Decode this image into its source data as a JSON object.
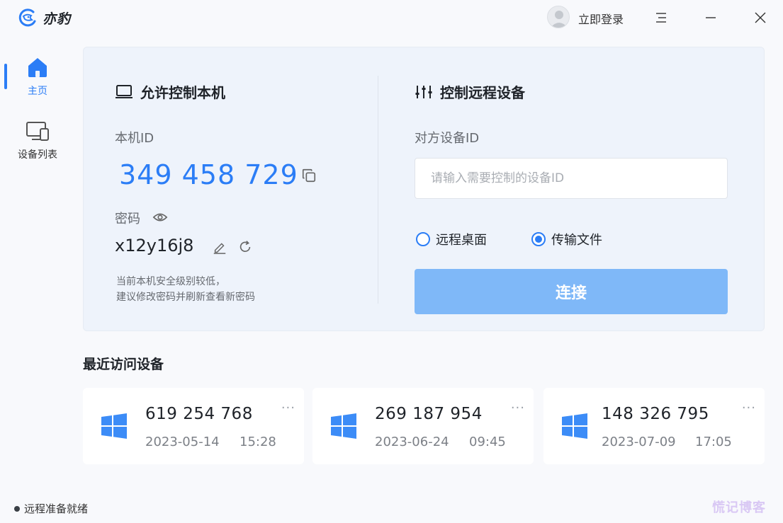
{
  "app": {
    "name": "亦豹"
  },
  "header": {
    "login_label": "立即登录"
  },
  "sidebar": {
    "items": [
      {
        "label": "主页",
        "icon": "home-icon",
        "active": true
      },
      {
        "label": "设备列表",
        "icon": "devices-icon",
        "active": false
      }
    ]
  },
  "local": {
    "title": "允许控制本机",
    "id_label": "本机ID",
    "device_id": "349 458 729",
    "password_label": "密码",
    "password": "x12y16j8",
    "hint_line1": "当前本机安全级别较低，",
    "hint_line2": "建议修改密码并刷新查看新密码"
  },
  "remote": {
    "title": "控制远程设备",
    "id_label": "对方设备ID",
    "input_value": "",
    "input_placeholder": "请输入需要控制的设备ID",
    "mode_desktop": "远程桌面",
    "mode_file": "传输文件",
    "selected_mode": "传输文件",
    "connect_label": "连接"
  },
  "recent": {
    "title": "最近访问设备",
    "devices": [
      {
        "id": "619 254 768",
        "date": "2023-05-14",
        "time": "15:28"
      },
      {
        "id": "269 187 954",
        "date": "2023-06-24",
        "time": "09:45"
      },
      {
        "id": "148 326 795",
        "date": "2023-07-09",
        "time": "17:05"
      }
    ],
    "more_label": "···"
  },
  "status": {
    "text": "远程准备就绪"
  },
  "watermark": {
    "text": "慌记博客"
  },
  "colors": {
    "accent": "#2b7df6",
    "connect_button": "#7fb8f8",
    "card_bg": "#eef3fb"
  }
}
